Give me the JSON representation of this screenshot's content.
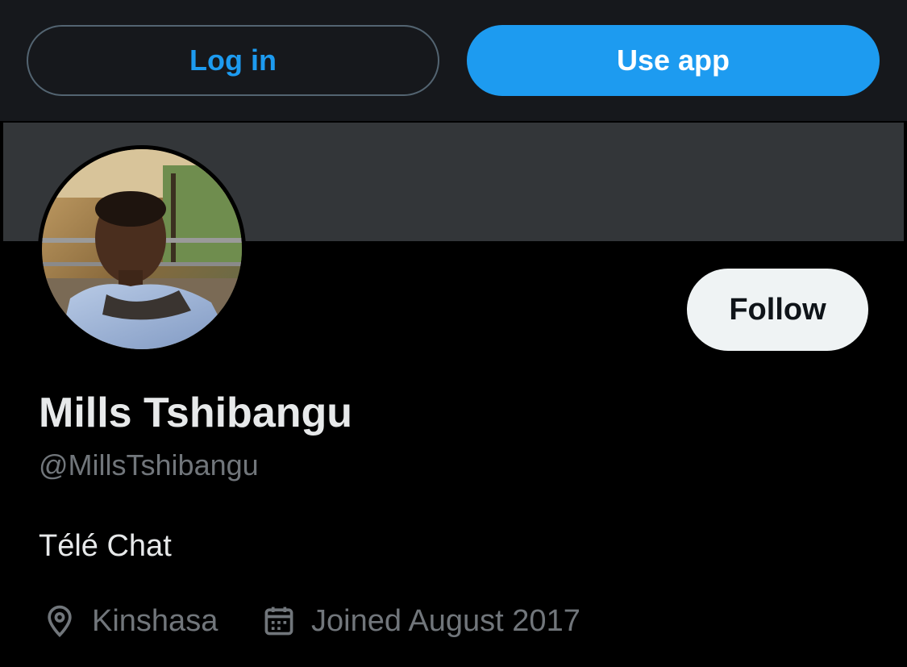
{
  "header": {
    "login_label": "Log in",
    "use_app_label": "Use app"
  },
  "profile": {
    "display_name": "Mills Tshibangu",
    "handle": "@MillsTshibangu",
    "bio": "Télé Chat",
    "follow_label": "Follow",
    "location": "Kinshasa",
    "joined": "Joined August 2017",
    "avatar_alt": "Mills Tshibangu"
  },
  "icons": {
    "location": "location-pin-icon",
    "calendar": "calendar-icon"
  },
  "colors": {
    "accent": "#1d9bf0",
    "background": "#000000",
    "top_bar": "#16181c",
    "banner": "#333639",
    "text_primary": "#e7e9ea",
    "text_secondary": "#71767b",
    "follow_bg": "#eff3f4"
  }
}
